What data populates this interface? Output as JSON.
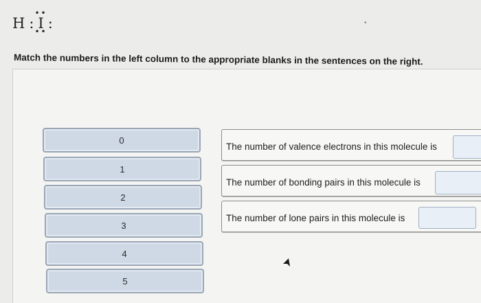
{
  "formula": {
    "left": "H",
    "colon": ":",
    "center": "I",
    "right_colon": ":"
  },
  "instruction": "Match the numbers in the left column to the appropriate blanks in the sentences on the right.",
  "chips": [
    "0",
    "1",
    "2",
    "3",
    "4",
    "5"
  ],
  "sentences": [
    {
      "text": "The number of valence electrons in this molecule is"
    },
    {
      "text": "The number of bonding pairs in this molecule is"
    },
    {
      "text": "The number of lone pairs in this molecule is"
    }
  ],
  "icons": {
    "pointer": "mouse-pointer-icon"
  },
  "colors": {
    "chip_fill": "#cfd9e6",
    "chip_border": "#9aa6b5",
    "blank_fill": "#e9eff7"
  }
}
